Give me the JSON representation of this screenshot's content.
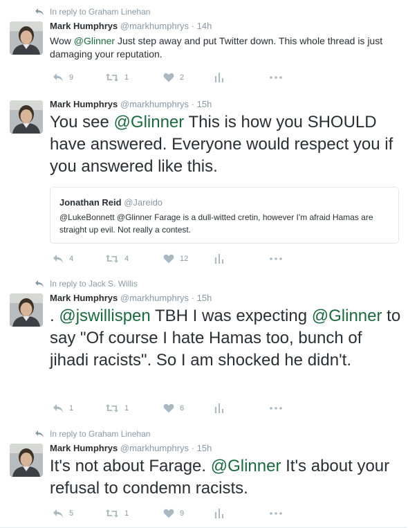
{
  "colors": {
    "mention": "#1b6a3e",
    "muted": "#8899a6",
    "border": "#e1e8ed",
    "text": "#292f33"
  },
  "tweets": [
    {
      "reply_to": "In reply to Graham Linehan",
      "name": "Mark Humphrys",
      "handle": "@markhumphrys",
      "sep": "·",
      "time": "14h",
      "text_parts": [
        "Wow ",
        "@Glinner",
        "  Just step away and put Twitter down. This whole thread is just damaging your reputation."
      ],
      "reply_count": "9",
      "retweet_count": "1",
      "like_count": "2",
      "icons": [
        "reply-icon",
        "retweet-icon",
        "heart-icon",
        "analytics-icon",
        "more-icon"
      ]
    },
    {
      "name": "Mark Humphrys",
      "handle": "@markhumphrys",
      "sep": "·",
      "time": "15h",
      "text_parts": [
        "You see ",
        "@Glinner",
        "  This is how you SHOULD have answered. Everyone would respect you if you answered like this."
      ],
      "quote": {
        "name": "Jonathan Reid",
        "handle": "@Jareido",
        "text": "@LukeBonnett @Glinner Farage is a dull-witted cretin, however I'm afraid Hamas are straight up evil. Not really a contest."
      },
      "reply_count": "4",
      "retweet_count": "4",
      "like_count": "12"
    },
    {
      "reply_to": "In reply to Jack S. Willis",
      "name": "Mark Humphrys",
      "handle": "@markhumphrys",
      "sep": "·",
      "time": "15h",
      "text_parts": [
        ". ",
        "@jswillispen",
        "  TBH I was expecting ",
        "@Glinner",
        " to say \"Of course I hate Hamas too, bunch of jihadi racists\". So I am shocked he didn't."
      ],
      "reply_count": "1",
      "retweet_count": "1",
      "like_count": "6"
    },
    {
      "reply_to": "In reply to Graham Linehan",
      "name": "Mark Humphrys",
      "handle": "@markhumphrys",
      "sep": "·",
      "time": "15h",
      "text_parts": [
        "It's not about Farage.  ",
        "@Glinner",
        "   It's about your refusal to condemn racists."
      ],
      "reply_count": "5",
      "retweet_count": "1",
      "like_count": "9"
    }
  ]
}
